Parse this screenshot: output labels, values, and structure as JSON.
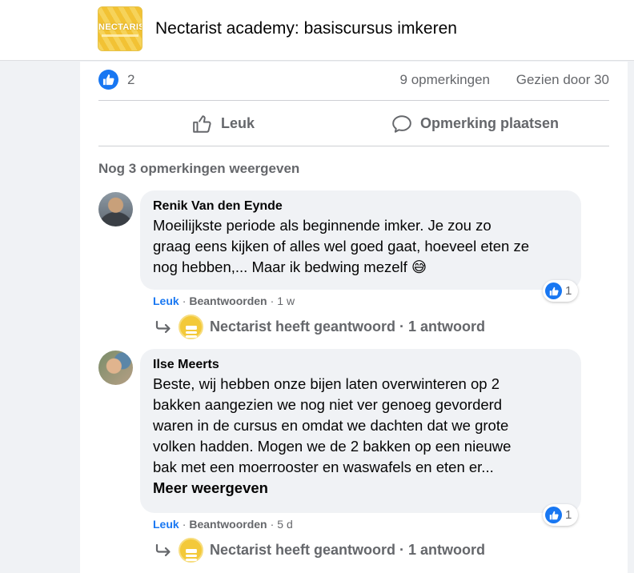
{
  "header": {
    "title": "Nectarist academy: basiscursus imkeren",
    "logo_text": "NECTARIST"
  },
  "stats": {
    "like_count": "2",
    "comments": "9 opmerkingen",
    "seen": "Gezien door 30"
  },
  "actions": {
    "like": "Leuk",
    "comment": "Opmerking plaatsen"
  },
  "more_comments": "Nog 3 opmerkingen weergeven",
  "comments": [
    {
      "author": "Renik Van den Eynde",
      "lines": [
        "Moeilijkste periode als beginnende imker. Je zou zo",
        "graag eens kijken of alles wel goed gaat, hoeveel eten ze",
        "nog hebben,... Maar ik bedwing mezelf 😅"
      ],
      "reactions": "1",
      "like": "Leuk",
      "reply": "Beantwoorden",
      "time": "1 w",
      "replies": "Nectarist heeft geantwoord · 1 antwoord"
    },
    {
      "author": "Ilse Meerts",
      "lines": [
        "Beste, wij hebben onze bijen laten overwinteren op 2",
        "bakken aangezien we nog niet ver genoeg gevorderd",
        "waren in de cursus en omdat we dachten dat we grote",
        "volken hadden. Mogen we de 2 bakken op een nieuwe",
        "bak met een moerrooster en waswafels en eten er..."
      ],
      "see_more": "Meer weergeven",
      "reactions": "1",
      "like": "Leuk",
      "reply": "Beantwoorden",
      "time": "5 d",
      "replies": "Nectarist heeft geantwoord · 1 antwoord"
    }
  ],
  "colors": {
    "accent": "#1877f2",
    "secondary_text": "#65676b",
    "bubble": "#f0f2f5"
  }
}
